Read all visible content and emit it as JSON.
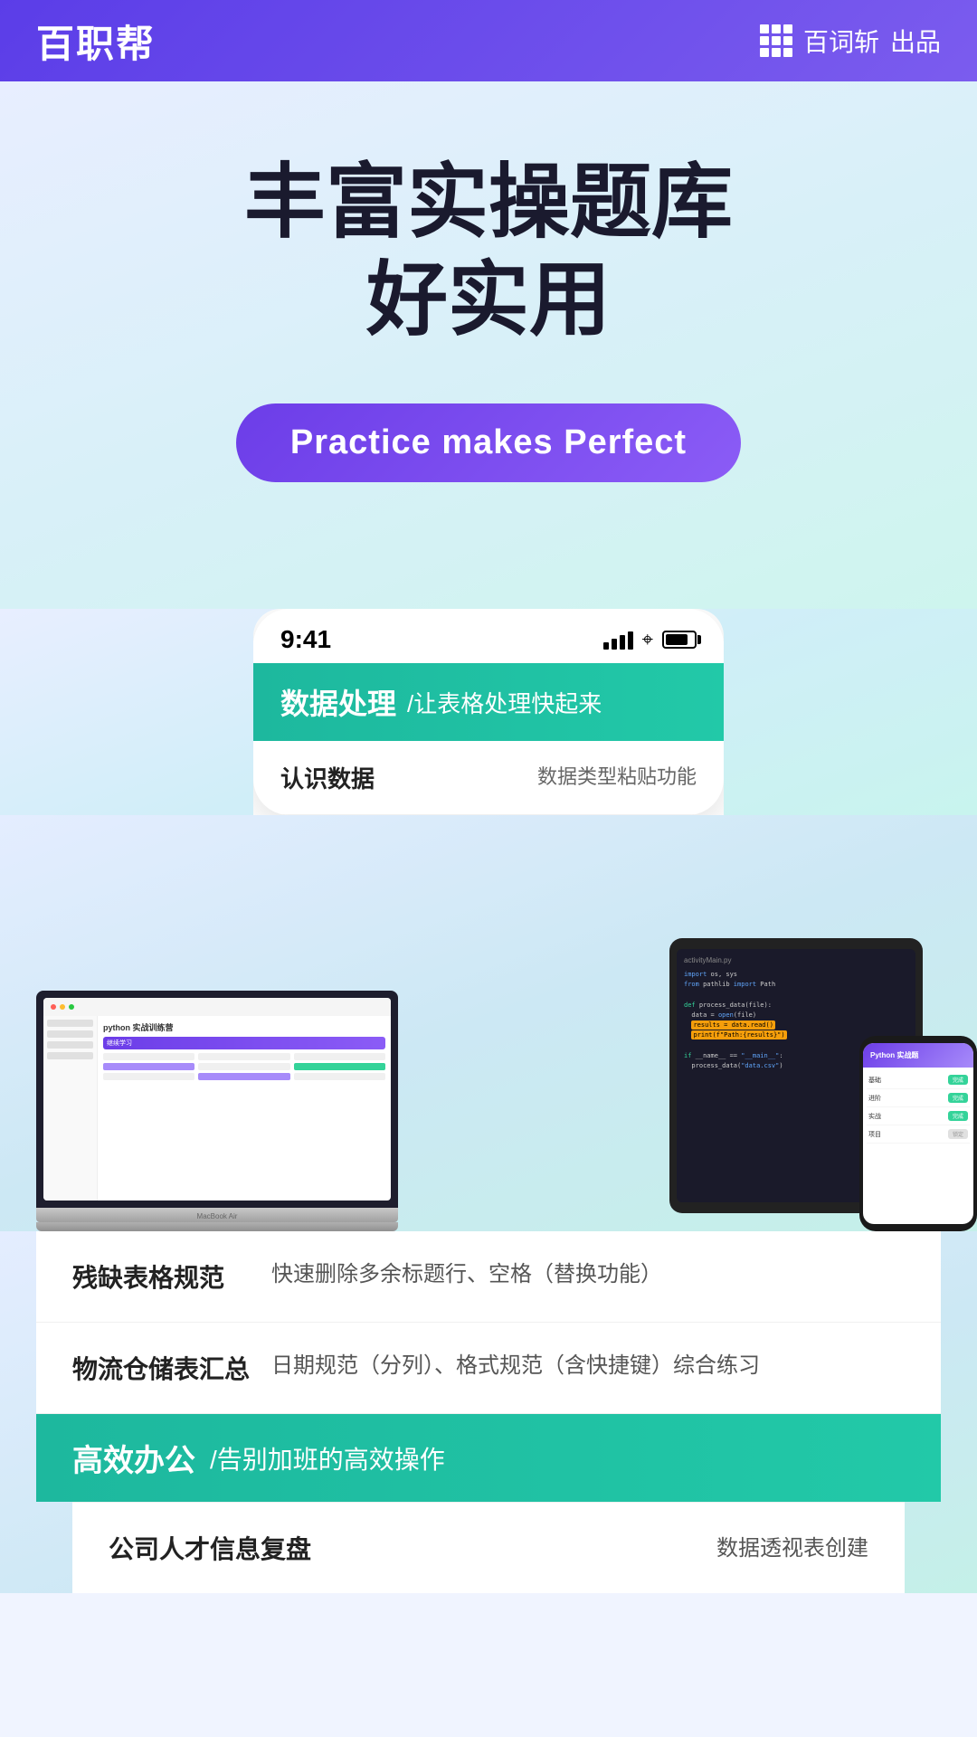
{
  "header": {
    "logo": "百职帮",
    "publisher_icon": "grid-icon",
    "publisher": "百词斩",
    "publisher_suffix": "出品"
  },
  "hero": {
    "title_line1": "丰富实操题库",
    "title_line2": "好实用",
    "badge": "Practice makes Perfect"
  },
  "phone_mockup": {
    "time": "9:41",
    "section1_tag": "数据处理",
    "section1_sub": "/让表格处理快起来",
    "list_items": [
      {
        "label": "认识数据",
        "desc": "数据类型粘贴功能"
      },
      {
        "label": "残缺表格规范",
        "desc": "快速删除多余标题行、空格（替换功能）"
      },
      {
        "label": "物流仓储表汇总",
        "desc": "日期规范（分列）、格式规范（含快捷键）综合练习"
      }
    ]
  },
  "section2": {
    "tag": "高效办公",
    "sub": "/告别加班的高效操作"
  },
  "last_section": {
    "label": "公司人才信息复盘",
    "desc": "数据透视表创建"
  },
  "colors": {
    "purple": "#6c3de8",
    "green": "#1db89e",
    "header_bg": "#5b3de8"
  }
}
